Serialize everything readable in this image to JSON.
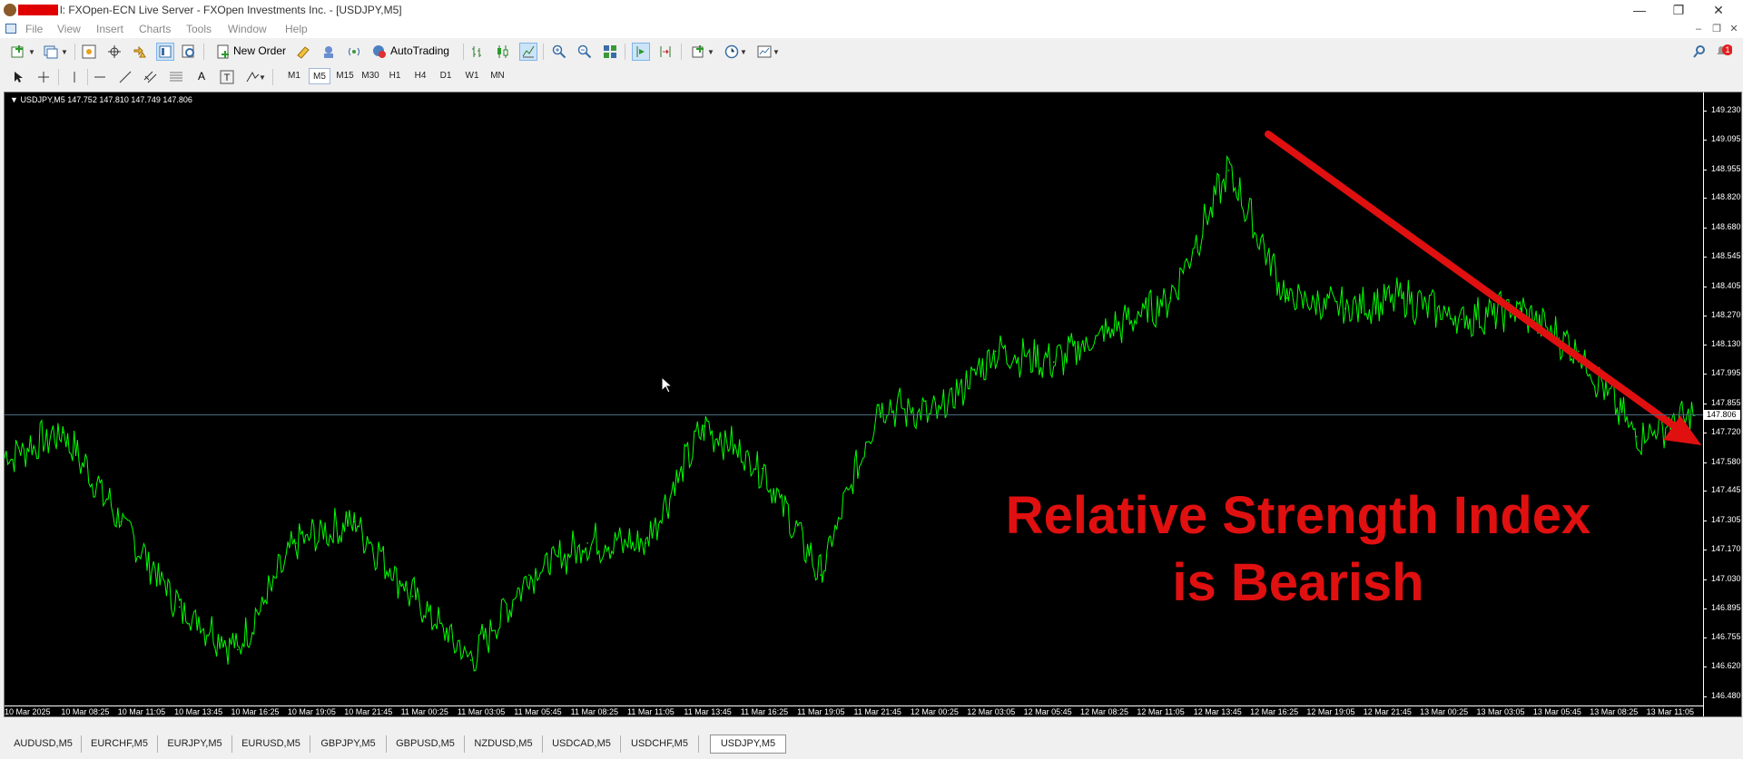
{
  "window": {
    "title": "l: FXOpen-ECN Live Server - FXOpen Investments Inc. - [USDJPY,M5]",
    "minimize": "—",
    "restore": "❐",
    "close": "✕"
  },
  "menu": {
    "items": [
      "File",
      "View",
      "Insert",
      "Charts",
      "Tools",
      "Window",
      "Help"
    ],
    "mdi_minimize": "–",
    "mdi_restore": "❐",
    "mdi_close": "✕"
  },
  "toolbar": {
    "new_order": "New Order",
    "autotrading": "AutoTrading",
    "notification_count": "1",
    "text_tool": "A",
    "text_label_tool": "T"
  },
  "timeframes": [
    "M1",
    "M5",
    "M15",
    "M30",
    "H1",
    "H4",
    "D1",
    "W1",
    "MN"
  ],
  "active_timeframe": "M5",
  "chart": {
    "header": "USDJPY,M5  147.752 147.810 147.749 147.806",
    "current_price": "147.806",
    "annotation_line1": "Relative Strength Index",
    "annotation_line2": "is Bearish",
    "line_color": "#00ff00",
    "arrow_color": "#e01010"
  },
  "tabs": [
    "AUDUSD,M5",
    "EURCHF,M5",
    "EURJPY,M5",
    "EURUSD,M5",
    "GBPJPY,M5",
    "GBPUSD,M5",
    "NZDUSD,M5",
    "USDCAD,M5",
    "USDCHF,M5",
    "USDJPY,M5"
  ],
  "active_tab": "USDJPY,M5",
  "chart_data": {
    "type": "line",
    "symbol": "USDJPY",
    "timeframe": "M5",
    "y_ticks": [
      "149.230",
      "149.095",
      "148.955",
      "148.820",
      "148.680",
      "148.545",
      "148.405",
      "148.270",
      "148.130",
      "147.995",
      "147.855",
      "147.720",
      "147.580",
      "147.445",
      "147.305",
      "147.170",
      "147.030",
      "146.895",
      "146.755",
      "146.620",
      "146.480"
    ],
    "x_ticks": [
      "10 Mar 2025",
      "10 Mar 08:25",
      "10 Mar 11:05",
      "10 Mar 13:45",
      "10 Mar 16:25",
      "10 Mar 19:05",
      "10 Mar 21:45",
      "11 Mar 00:25",
      "11 Mar 03:05",
      "11 Mar 05:45",
      "11 Mar 08:25",
      "11 Mar 11:05",
      "11 Mar 13:45",
      "11 Mar 16:25",
      "11 Mar 19:05",
      "11 Mar 21:45",
      "12 Mar 00:25",
      "12 Mar 03:05",
      "12 Mar 05:45",
      "12 Mar 08:25",
      "12 Mar 11:05",
      "12 Mar 13:45",
      "12 Mar 16:25",
      "12 Mar 19:05",
      "12 Mar 21:45",
      "13 Mar 00:25",
      "13 Mar 03:05",
      "13 Mar 05:45",
      "13 Mar 08:25",
      "13 Mar 11:05"
    ],
    "ylim": [
      146.48,
      149.23
    ],
    "series": [
      {
        "x": [
          "10 Mar 2025",
          "10 Mar 08:25",
          "10 Mar 11:05",
          "10 Mar 13:45",
          "10 Mar 16:25",
          "10 Mar 19:05",
          "10 Mar 21:45",
          "11 Mar 00:25",
          "11 Mar 03:05",
          "11 Mar 05:45",
          "11 Mar 08:25",
          "11 Mar 11:05",
          "11 Mar 13:45",
          "11 Mar 16:25",
          "11 Mar 19:05",
          "11 Mar 21:45",
          "12 Mar 00:25",
          "12 Mar 03:05",
          "12 Mar 05:45",
          "12 Mar 08:25",
          "12 Mar 11:05",
          "12 Mar 13:45",
          "12 Mar 16:25",
          "12 Mar 19:05",
          "12 Mar 21:45",
          "13 Mar 00:25",
          "13 Mar 03:05",
          "13 Mar 05:45",
          "13 Mar 08:25",
          "13 Mar 11:05"
        ],
        "values": [
          147.6,
          147.72,
          147.3,
          146.9,
          146.7,
          147.2,
          147.3,
          146.95,
          146.65,
          147.05,
          147.2,
          147.2,
          147.75,
          147.55,
          147.05,
          147.85,
          147.8,
          148.1,
          148.05,
          148.2,
          148.35,
          148.95,
          148.35,
          148.3,
          148.35,
          148.25,
          148.3,
          148.1,
          147.7,
          147.8
        ]
      }
    ]
  }
}
